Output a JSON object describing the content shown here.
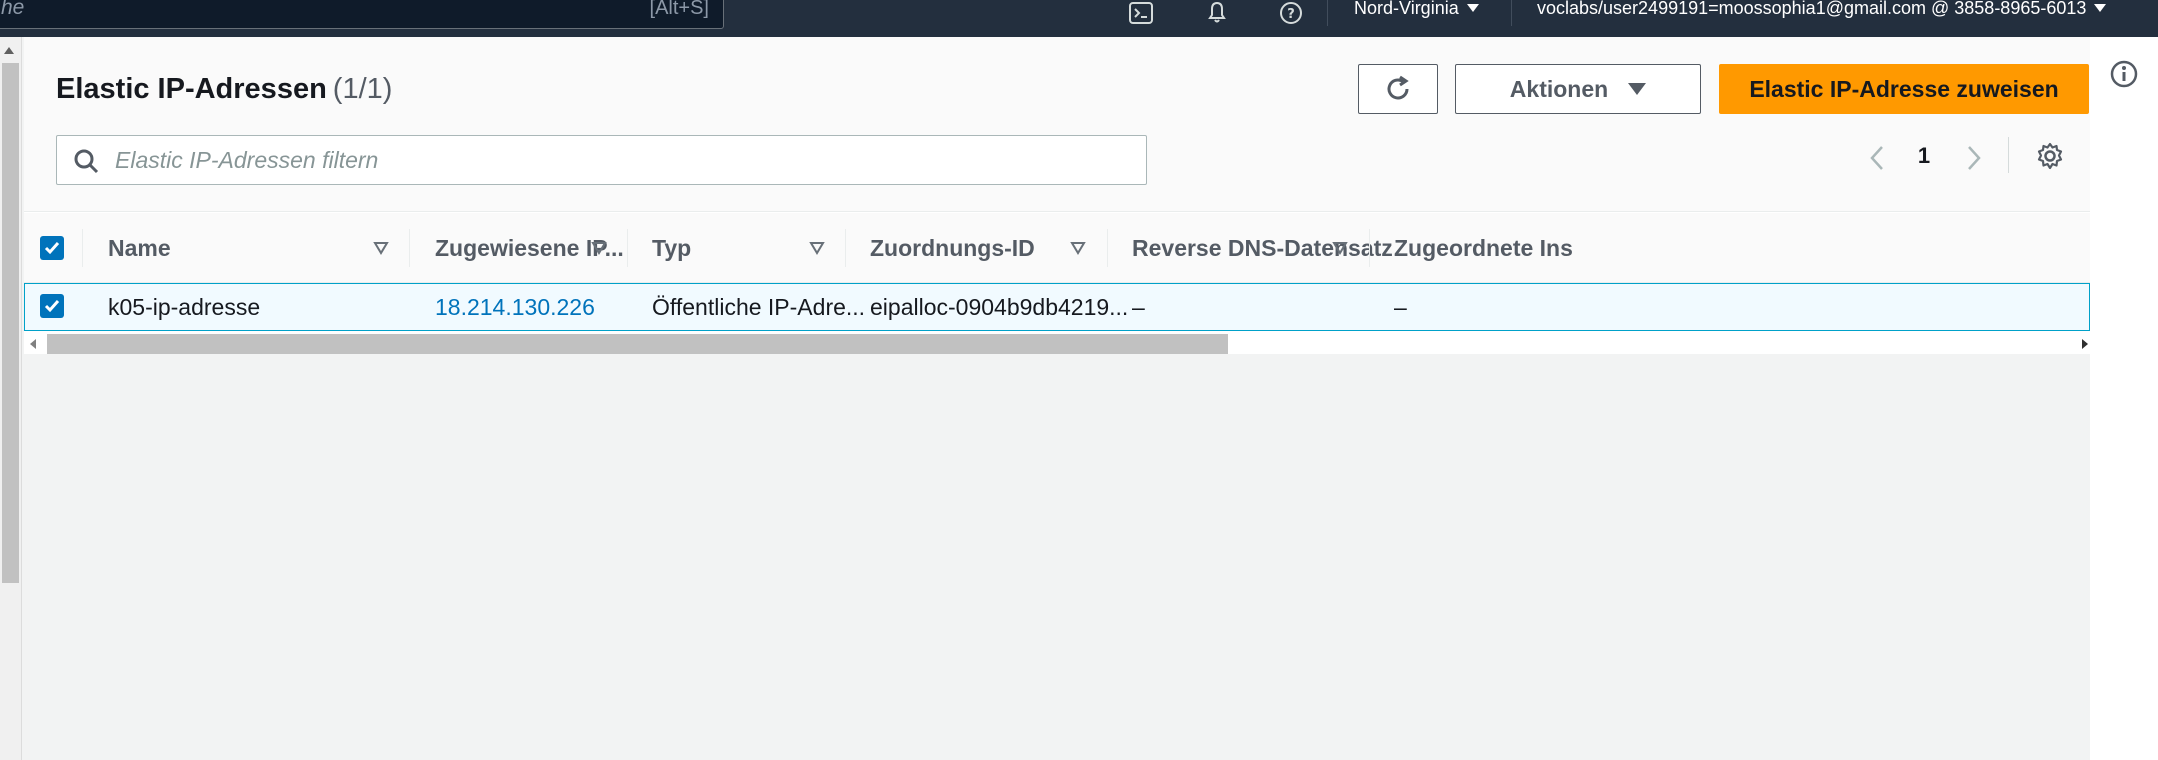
{
  "topbar": {
    "search_placeholder": "he",
    "search_shortcut": "[Alt+S]",
    "region": "Nord-Virginia",
    "account": "voclabs/user2499191=moossophia1@gmail.com @ 3858-8965-6013"
  },
  "header": {
    "title": "Elastic IP-Adressen",
    "count": "(1/1)",
    "actions_label": "Aktionen",
    "primary_label": "Elastic IP-Adresse zuweisen",
    "filter_placeholder": "Elastic IP-Adressen filtern"
  },
  "pagination": {
    "current_page": "1"
  },
  "table": {
    "columns": [
      "Name",
      "Zugewiesene IP...",
      "Typ",
      "Zuordnungs-ID",
      "Reverse DNS-Datensatz",
      "Zugeordnete Ins"
    ],
    "rows": [
      {
        "selected": true,
        "name": "k05-ip-adresse",
        "ip": "18.214.130.226",
        "type": "Öffentliche IP-Adre...",
        "allocation_id": "eipalloc-0904b9db4219...",
        "reverse_dns": "–",
        "instance": "–"
      }
    ]
  },
  "colors": {
    "topbar": "#232f3e",
    "primary": "#ff9900",
    "link": "#0073bb",
    "selected_row": "#f1faff",
    "selected_border": "#00a1c9"
  }
}
